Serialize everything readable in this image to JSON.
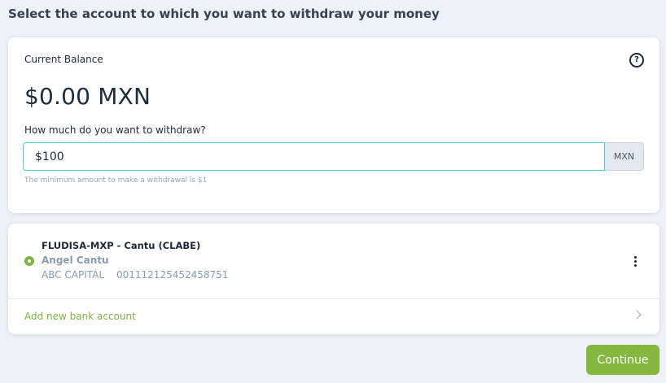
{
  "header": {
    "title": "Select the account to which you want to withdraw your money"
  },
  "balance": {
    "label": "Current Balance",
    "help_icon": "question-circle-icon",
    "amount": "$0.00 MXN"
  },
  "withdraw": {
    "label": "How much do you want to withdraw?",
    "value": "$100",
    "currency": "MXN",
    "hint": "The minimum amount to make a withdrawal is $1"
  },
  "account": {
    "title": "FLUDISA-MXP - Cantu (CLABE)",
    "holder": "Angel Cantu",
    "bank": "ABC CAPITAL",
    "number": "001112125452458751",
    "selected": true
  },
  "add_bank": {
    "label": "Add new bank account"
  },
  "actions": {
    "continue_label": "Continue"
  },
  "colors": {
    "accent_green": "#86b73e",
    "input_border": "#4ecdc0",
    "muted_text": "#8a9bb0",
    "background": "#eef1f7"
  }
}
